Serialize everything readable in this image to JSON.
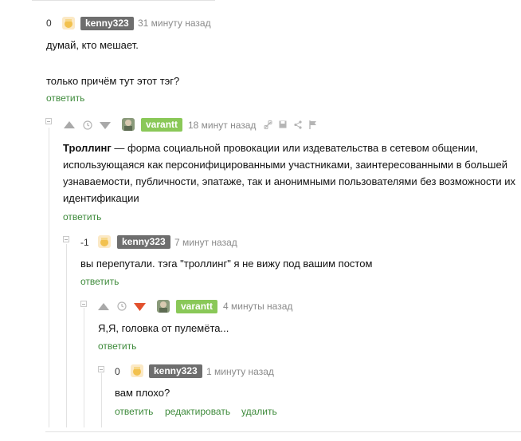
{
  "colors": {
    "gray_badge": "#6e6e6e",
    "green_badge": "#8ac858",
    "link_green": "#3d8a3a",
    "downvote_red": "#e2512d"
  },
  "comments": [
    {
      "score": "0",
      "username": "kenny323",
      "time": "31 минуту назад",
      "lines": [
        "думай, кто мешает.",
        "только причём тут этот тэг?"
      ],
      "reply": "ответить"
    },
    {
      "username": "varantt",
      "time": "18 минут назад",
      "term": "Троллинг",
      "lines": [
        " — форма социальной провокации или издевательства в сетевом общении,",
        "использующаяся как персонифицированными участниками, заинтересованными в большей",
        "узнаваемости, публичности, эпатаже, так и анонимными пользователями без возможности их",
        "идентификации"
      ],
      "reply": "ответить"
    },
    {
      "score": "-1",
      "username": "kenny323",
      "time": "7 минут назад",
      "lines": [
        "вы перепутали. тэга \"троллинг\" я не вижу под вашим постом"
      ],
      "reply": "ответить"
    },
    {
      "username": "varantt",
      "time": "4 минуты назад",
      "lines": [
        "Я,Я, головка от пулемёта..."
      ],
      "reply": "ответить"
    },
    {
      "score": "0",
      "username": "kenny323",
      "time": "1 минуту назад",
      "lines": [
        "вам плохо?"
      ],
      "reply": "ответить",
      "edit": "редактировать",
      "delete": "удалить"
    }
  ]
}
